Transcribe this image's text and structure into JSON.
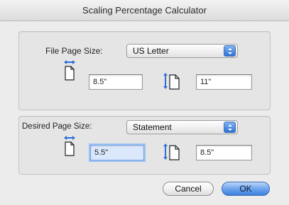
{
  "window": {
    "title": "Scaling Percentage Calculator"
  },
  "file_page_size": {
    "label": "File Page Size:",
    "selected": "US Letter",
    "width": "8.5\"",
    "height": "11\""
  },
  "desired_page_size": {
    "label": "Desired Page Size:",
    "selected": "Statement",
    "width": "5.5\"",
    "height": "8.5\""
  },
  "buttons": {
    "cancel": "Cancel",
    "ok": "OK"
  },
  "icons": {
    "width": "page-width-icon",
    "height": "page-height-icon",
    "popup": "popup-arrows-icon"
  },
  "colors": {
    "accent": "#3d7fe0",
    "focus": "#9cc0f1"
  }
}
